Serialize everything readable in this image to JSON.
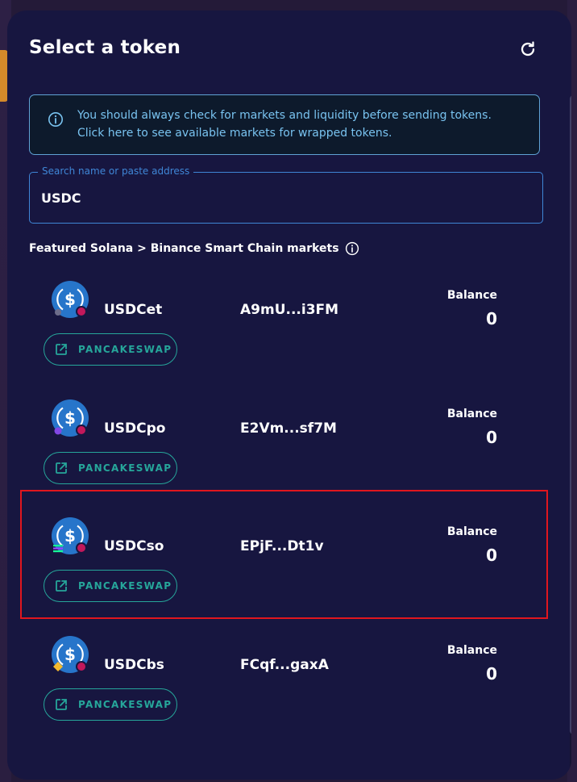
{
  "modal": {
    "title": "Select a token",
    "refresh_icon": "refresh-icon"
  },
  "notice": {
    "icon": "info-icon",
    "line1": "You should always check for markets and liquidity before sending tokens.",
    "line2": "Click here to see available markets for wrapped tokens."
  },
  "search": {
    "legend": "Search name or paste address",
    "value": "USDC"
  },
  "featured": {
    "label": "Featured Solana > Binance Smart Chain markets",
    "icon": "info-icon"
  },
  "tokens": [
    {
      "name": "USDCet",
      "address": "A9mU...i3FM",
      "balance_label": "Balance",
      "balance": "0",
      "market_label": "PANCAKESWAP"
    },
    {
      "name": "USDCpo",
      "address": "E2Vm...sf7M",
      "balance_label": "Balance",
      "balance": "0",
      "market_label": "PANCAKESWAP"
    },
    {
      "name": "USDCso",
      "address": "EPjF...Dt1v",
      "balance_label": "Balance",
      "balance": "0",
      "market_label": "PANCAKESWAP"
    },
    {
      "name": "USDCbs",
      "address": "FCqf...gaxA",
      "balance_label": "Balance",
      "balance": "0",
      "market_label": "PANCAKESWAP"
    }
  ],
  "colors": {
    "modal_bg": "#171640",
    "accent_teal": "#26a69a",
    "notice_text": "#79c3f0",
    "search_border": "#3f86d6",
    "highlight": "#e0161e",
    "usdc_blue": "#2775ca"
  }
}
